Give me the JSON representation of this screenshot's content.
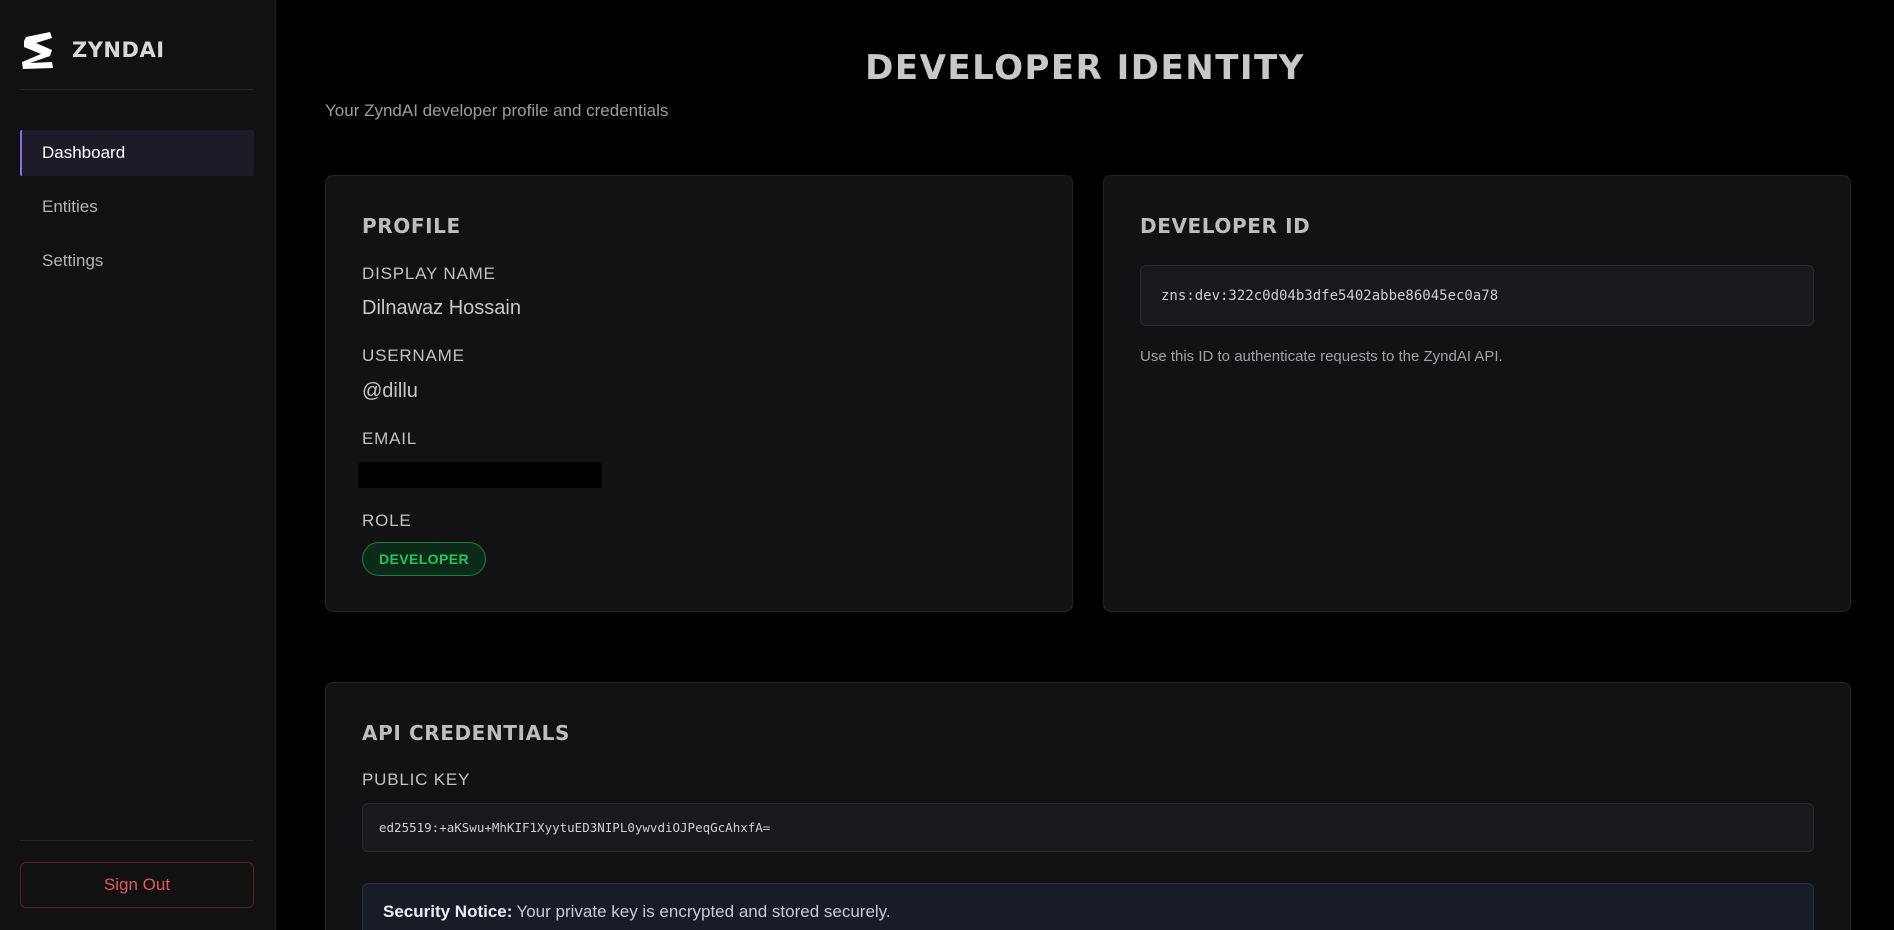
{
  "sidebar": {
    "brand": "ZYNDAI",
    "nav": [
      {
        "label": "Dashboard",
        "active": true
      },
      {
        "label": "Entities",
        "active": false
      },
      {
        "label": "Settings",
        "active": false
      }
    ],
    "sign_out_label": "Sign Out"
  },
  "header": {
    "title": "DEVELOPER IDENTITY",
    "subtitle": "Your ZyndAI developer profile and credentials"
  },
  "profile": {
    "title": "PROFILE",
    "display_name_label": "DISPLAY NAME",
    "display_name": "Dilnawaz Hossain",
    "username_label": "USERNAME",
    "username": "@dillu",
    "email_label": "EMAIL",
    "role_label": "ROLE",
    "role": "DEVELOPER"
  },
  "developer_id": {
    "title": "DEVELOPER ID",
    "value": "zns:dev:322c0d04b3dfe5402abbe86045ec0a78",
    "helper": "Use this ID to authenticate requests to the ZyndAI API."
  },
  "api_credentials": {
    "title": "API CREDENTIALS",
    "public_key_label": "PUBLIC KEY",
    "public_key": "ed25519:+aKSwu+MhKIF1XyytuED3NIPL0ywvdiOJPeqGcAhxfA=",
    "notice_strong": "Security Notice:",
    "notice_text": "Your private key is encrypted and stored securely."
  },
  "colors": {
    "accent": "#8b6cf0",
    "danger": "#e05a5a",
    "success": "#22c55e",
    "background": "#000000",
    "card": "#121214"
  }
}
